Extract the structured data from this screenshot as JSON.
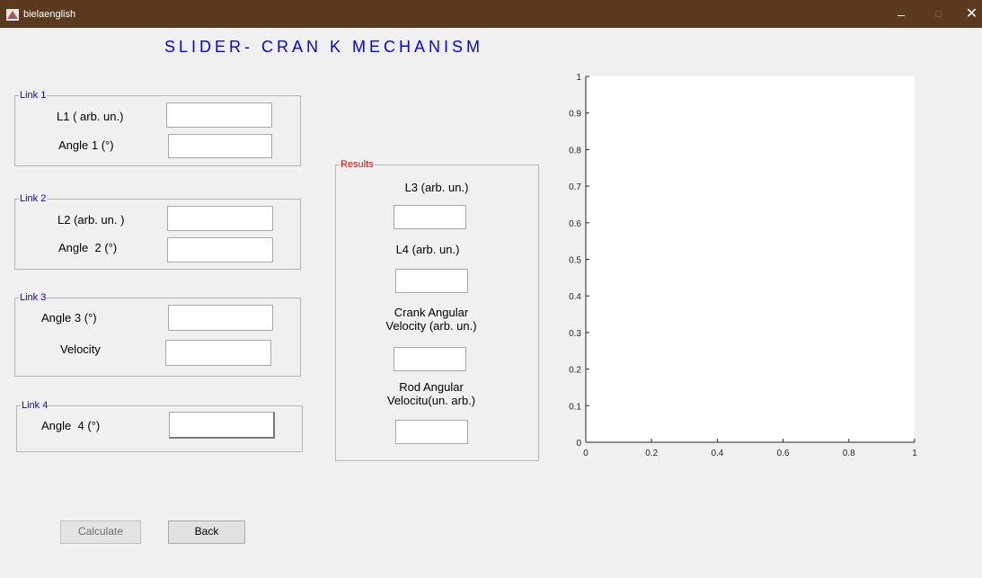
{
  "window": {
    "title": "bielaenglish",
    "controls": [
      "–",
      "□",
      "✕"
    ]
  },
  "main_title": "SLIDER- CRAN K MECHANISM",
  "link1": {
    "legend": "Link 1",
    "l1_label": "L1 ( arb. un.)",
    "angle_label": "Angle 1 (°)",
    "l1_value": "",
    "angle_value": ""
  },
  "link2": {
    "legend": "Link 2",
    "l2_label": "L2 (arb. un. )",
    "angle_label": "Angle  2 (°)",
    "l2_value": "",
    "angle_value": ""
  },
  "link3": {
    "legend": "Link 3",
    "angle_label": "Angle 3 (°)",
    "velocity_label": "Velocity",
    "angle_value": "",
    "velocity_value": ""
  },
  "link4": {
    "legend": "Link 4",
    "angle_label": "Angle  4 (°)",
    "angle_value": ""
  },
  "results": {
    "legend": "Results",
    "l3_label": "L3 (arb. un.)",
    "l4_label": "L4 (arb. un.)",
    "crank_label_1": "Crank Angular",
    "crank_label_2": "Velocity (arb. un.)",
    "rod_label_1": "Rod Angular",
    "rod_label_2": "Velocitu(un. arb.)",
    "l3_value": "",
    "l4_value": "",
    "crank_value": "",
    "rod_value": ""
  },
  "buttons": {
    "calculate": "Calculate",
    "back": "Back"
  },
  "chart_data": {
    "type": "line",
    "series": [],
    "xlim": [
      0,
      1
    ],
    "ylim": [
      0,
      1
    ],
    "x_ticks": [
      "0",
      "0.2",
      "0.4",
      "0.6",
      "0.8",
      "1"
    ],
    "y_ticks": [
      "0",
      "0.1",
      "0.2",
      "0.3",
      "0.4",
      "0.5",
      "0.6",
      "0.7",
      "0.8",
      "0.9",
      "1"
    ],
    "title": "",
    "xlabel": "",
    "ylabel": "",
    "grid": false
  }
}
